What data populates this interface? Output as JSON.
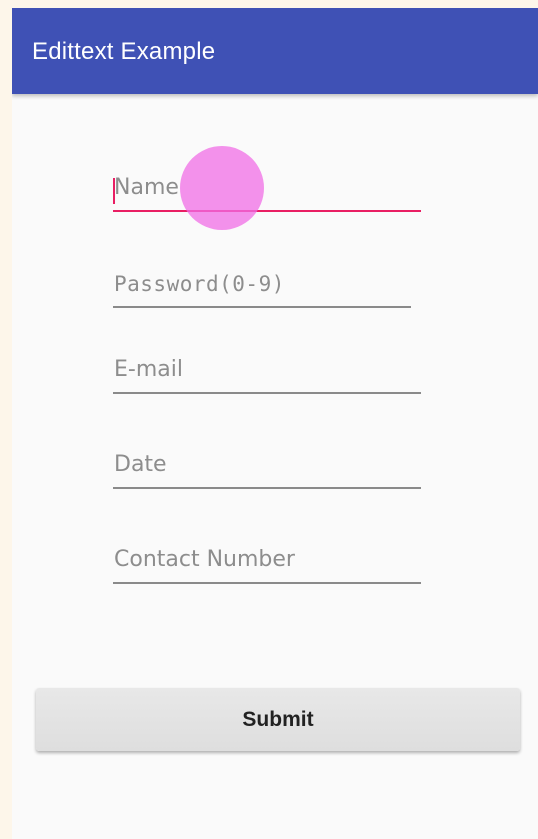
{
  "appbar": {
    "title": "Edittext Example",
    "color": "#3f51b5"
  },
  "form": {
    "name": {
      "placeholder": "Name",
      "focused": true
    },
    "password": {
      "placeholder": "Password(0-9)"
    },
    "email": {
      "placeholder": "E-mail"
    },
    "date": {
      "placeholder": "Date"
    },
    "contact": {
      "placeholder": "Contact Number"
    },
    "submit_label": "Submit"
  },
  "colors": {
    "accent": "#e91e63",
    "touch_indicator": "#f06ee6"
  }
}
